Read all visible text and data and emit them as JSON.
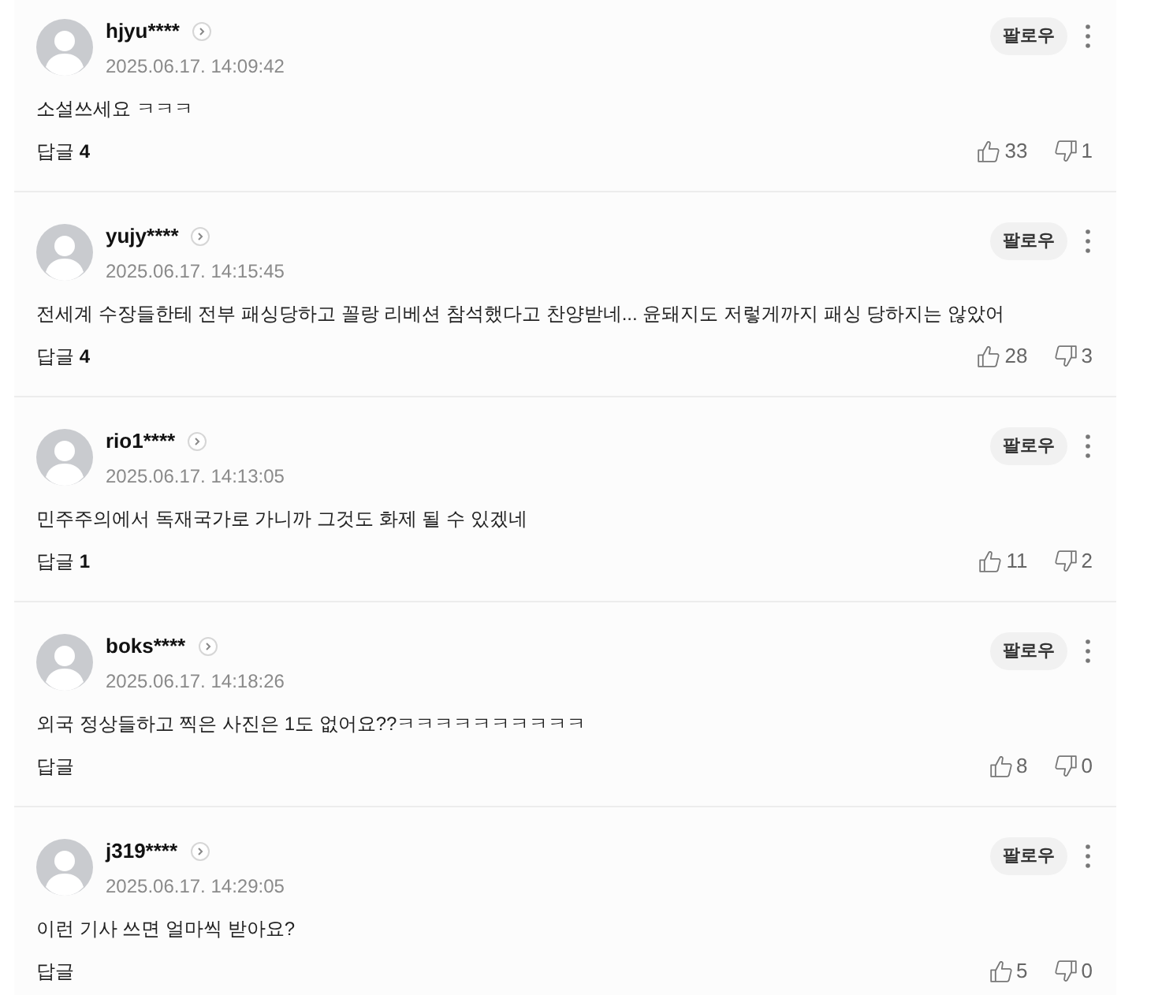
{
  "comments": [
    {
      "author": "hjyu****",
      "date": "2025.06.17. 14:09:42",
      "text": "소설쓰세요 ㅋㅋㅋ",
      "follow_label": "팔로우",
      "reply_label": "답글",
      "reply_count": "4",
      "likes": "33",
      "dislikes": "1"
    },
    {
      "author": "yujy****",
      "date": "2025.06.17. 14:15:45",
      "text": "전세계 수장들한테 전부 패싱당하고 꼴랑 리베션 참석했다고 찬양받네... 윤돼지도 저렇게까지 패싱 당하지는 않았어",
      "follow_label": "팔로우",
      "reply_label": "답글",
      "reply_count": "4",
      "likes": "28",
      "dislikes": "3"
    },
    {
      "author": "rio1****",
      "date": "2025.06.17. 14:13:05",
      "text": "민주주의에서 독재국가로 가니까 그것도 화제 될 수 있겠네",
      "follow_label": "팔로우",
      "reply_label": "답글",
      "reply_count": "1",
      "likes": "11",
      "dislikes": "2"
    },
    {
      "author": "boks****",
      "date": "2025.06.17. 14:18:26",
      "text": "외국 정상들하고 찍은 사진은 1도 없어요??ㅋㅋㅋㅋㅋㅋㅋㅋㅋㅋ",
      "follow_label": "팔로우",
      "reply_label": "답글",
      "likes": "8",
      "dislikes": "0"
    },
    {
      "author": "j319****",
      "date": "2025.06.17. 14:29:05",
      "text": "이런 기사 쓰면 얼마씩 받아요?",
      "follow_label": "팔로우",
      "reply_label": "답글",
      "likes": "5",
      "dislikes": "0"
    }
  ]
}
